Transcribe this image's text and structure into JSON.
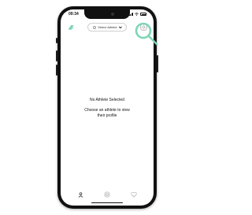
{
  "status_bar": {
    "time": "09:34"
  },
  "header": {
    "logo_icon": "brand-logo-icon",
    "select_athlete_label": "Select Athlete",
    "settings_icon": "settings-icon"
  },
  "empty_state": {
    "title": "No Athlete Selected",
    "body": "Choose an athlete to view their profile"
  },
  "tab_bar": {
    "tabs": [
      {
        "icon": "person-icon",
        "active": true
      },
      {
        "icon": "target-icon",
        "active": false
      },
      {
        "icon": "heart-icon",
        "active": false
      }
    ]
  },
  "colors": {
    "highlight": "#7ad6b4",
    "brand": "#6fcfb0",
    "text": "#111111",
    "muted_icon": "#9a9a9a"
  }
}
